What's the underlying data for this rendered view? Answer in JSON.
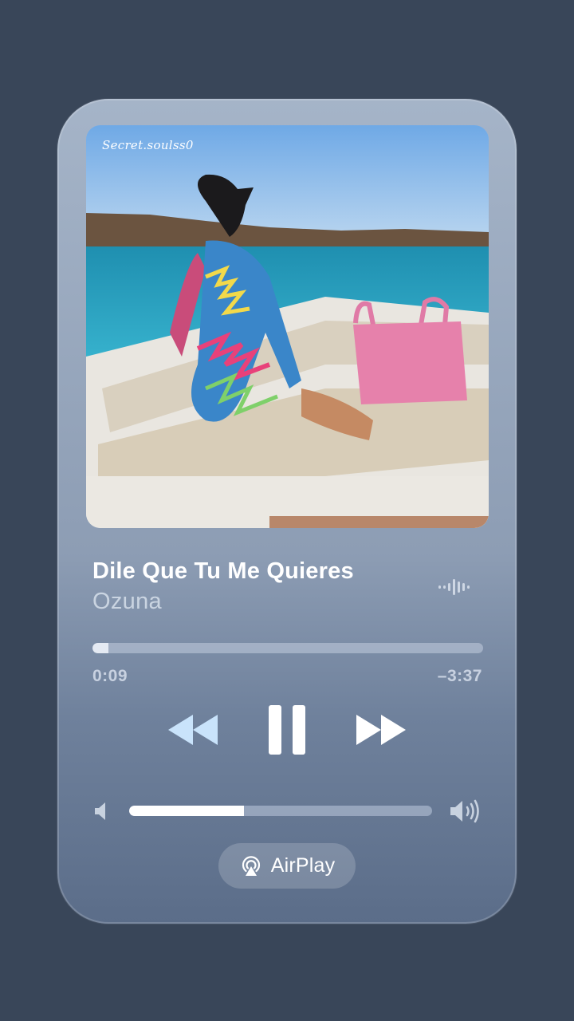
{
  "player": {
    "watermark": "Secret.soulss0",
    "track": {
      "title": "Dile Que Tu Me Quieres",
      "artist": "Ozuna"
    },
    "playback": {
      "elapsed": "0:09",
      "remaining": "–3:37",
      "progress_fraction": 0.04,
      "state": "playing"
    },
    "volume": {
      "level_fraction": 0.38
    },
    "airplay": {
      "label": "AirPlay"
    },
    "icons": {
      "waveform": "audio-waveform-icon",
      "rewind": "rewind-icon",
      "pause": "pause-icon",
      "forward": "fast-forward-icon",
      "volume_low": "speaker-low-icon",
      "volume_high": "speaker-high-icon",
      "airplay": "airplay-icon"
    },
    "colors": {
      "background": "#394659",
      "rewind_accent": "#c9e3fb",
      "text_primary": "#ffffff"
    }
  }
}
